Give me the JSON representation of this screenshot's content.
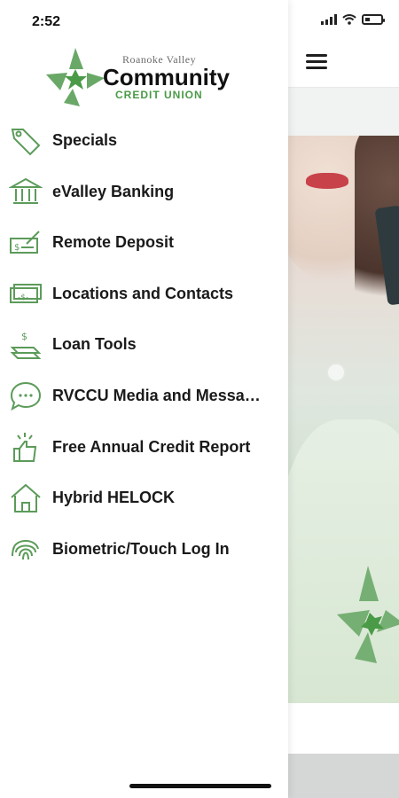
{
  "status": {
    "time": "2:52",
    "signal_bars": 4,
    "battery_level_fraction": 0.3
  },
  "logo": {
    "line1": "Roanoke Valley",
    "line2": "Community",
    "line3": "CREDIT UNION"
  },
  "menu": {
    "items": [
      {
        "label": "Specials",
        "icon": "tag-icon"
      },
      {
        "label": "eValley Banking",
        "icon": "bank-icon"
      },
      {
        "label": "Remote Deposit",
        "icon": "check-deposit-icon"
      },
      {
        "label": "Locations and Contacts",
        "icon": "money-bill-icon"
      },
      {
        "label": "Loan Tools",
        "icon": "cash-stack-icon"
      },
      {
        "label": "RVCCU Media and Messa…",
        "icon": "chat-bubble-icon"
      },
      {
        "label": "Free Annual Credit Report",
        "icon": "thumbs-up-icon"
      },
      {
        "label": "Hybrid HELOCK",
        "icon": "house-icon"
      },
      {
        "label": "Biometric/Touch Log In",
        "icon": "fingerprint-icon"
      }
    ]
  },
  "colors": {
    "brand_green": "#4a9a47",
    "icon_green": "#5c9b5a"
  }
}
